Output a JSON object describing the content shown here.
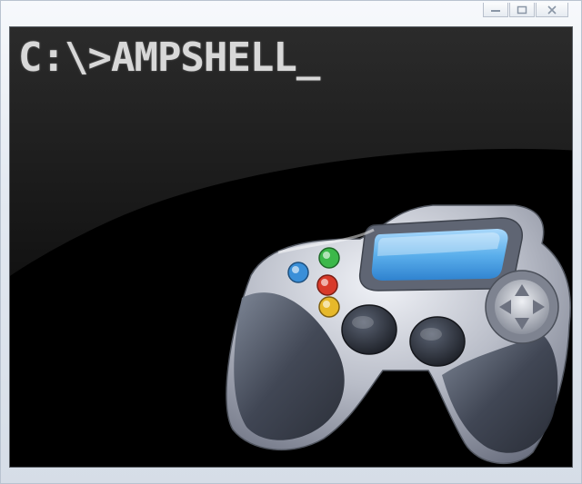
{
  "window": {
    "caption_buttons": [
      {
        "name": "minimize",
        "icon": "minimize-icon"
      },
      {
        "name": "maximize",
        "icon": "maximize-icon"
      },
      {
        "name": "close",
        "icon": "close-icon"
      }
    ]
  },
  "console": {
    "prompt_text": "C:\\>AMPSHELL_",
    "text_color": "#d8d8d8",
    "background_color": "#000000"
  },
  "artwork": {
    "icon": "gamepad-icon",
    "button_colors": [
      "#3a8fd8",
      "#3cb84a",
      "#d83a2a",
      "#e6b82a"
    ],
    "screen_color": "#5cb0ec"
  }
}
